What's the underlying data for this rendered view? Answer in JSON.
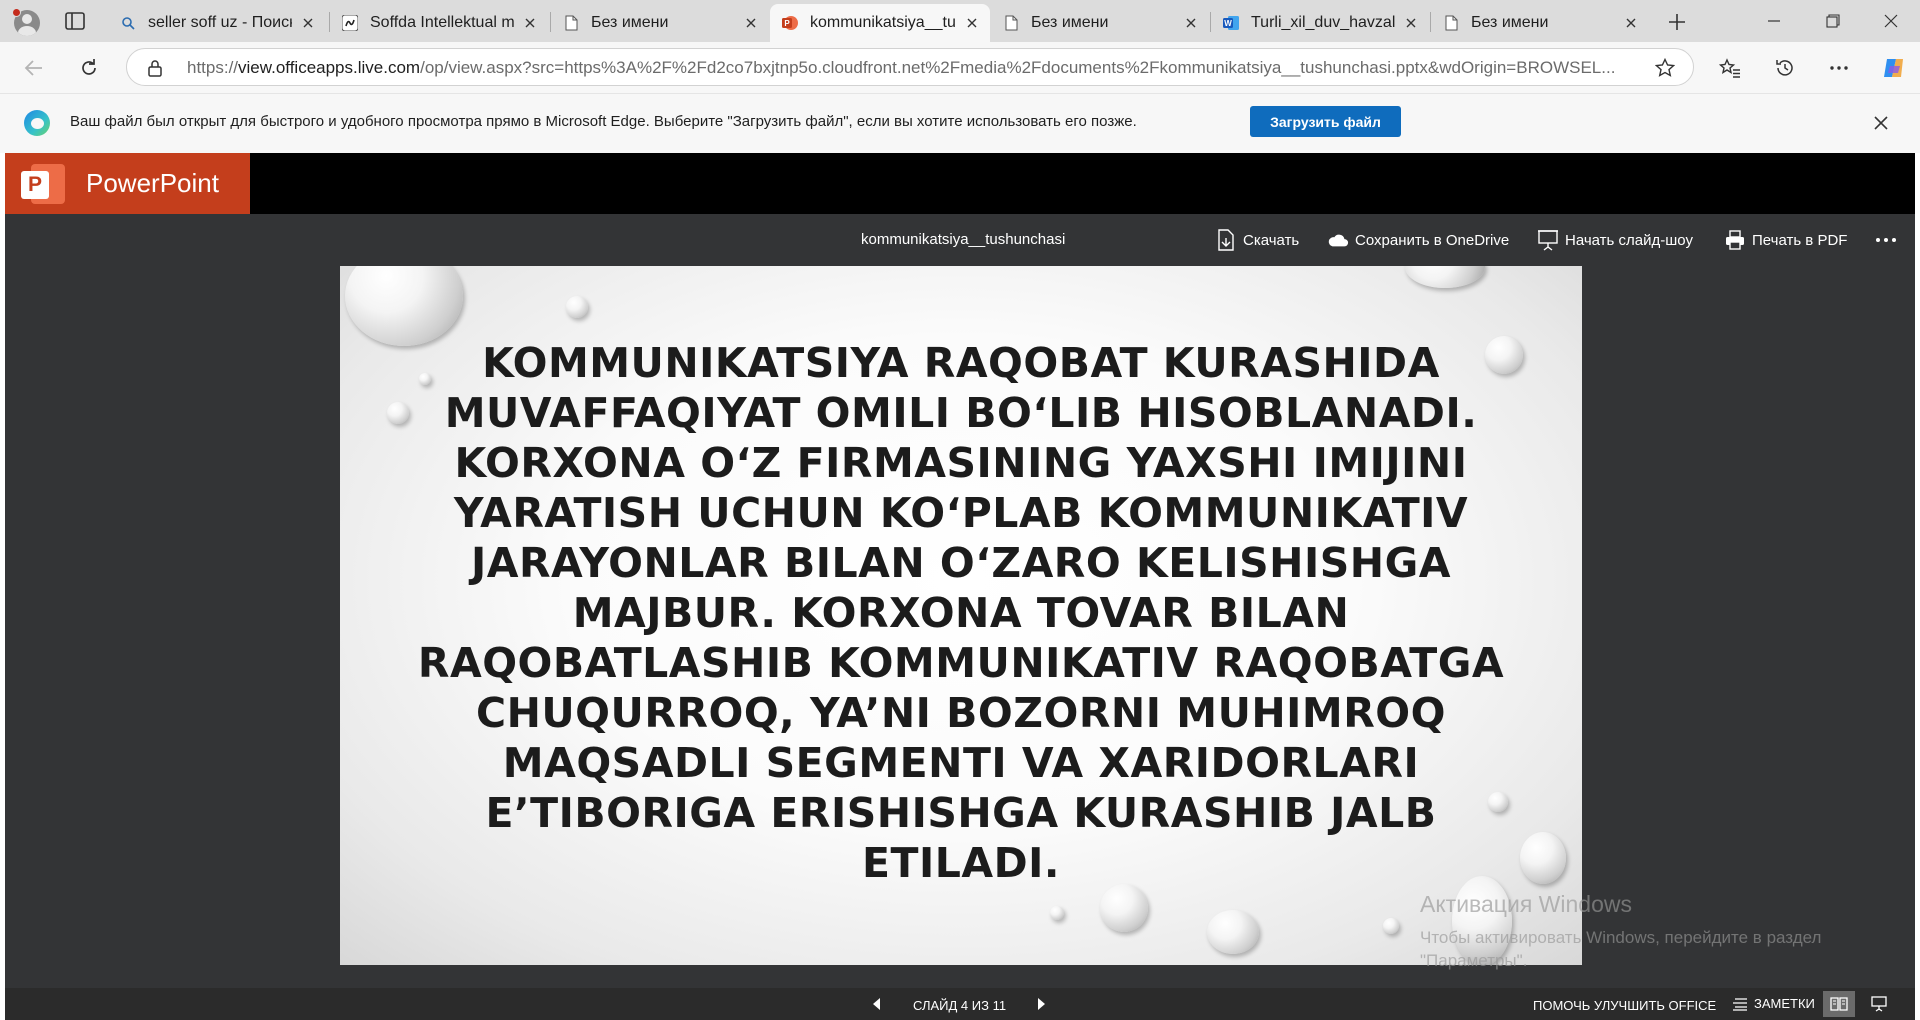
{
  "browser": {
    "tabs": [
      {
        "label": "seller soff uz - Поиск",
        "icon": "search-icon"
      },
      {
        "label": "Soffda Intellektual mu",
        "icon": "soff-icon"
      },
      {
        "label": "Без имени",
        "icon": "page-icon"
      },
      {
        "label": "kommunikatsiya__tushunchasi",
        "icon": "powerpoint-icon",
        "active": true
      },
      {
        "label": "Без имени",
        "icon": "page-icon"
      },
      {
        "label": "Turli_xil_duv_havzalari",
        "icon": "word-icon"
      },
      {
        "label": "Без имени",
        "icon": "page-icon"
      }
    ],
    "address": {
      "prefix": "https://",
      "host": "view.officeapps.live.com",
      "path": "/op/view.aspx?src=https%3A%2F%2Fd2co7bxjtnp5o.cloudfront.net%2Fmedia%2Fdocuments%2Fkommunikatsiya__tushunchasi.pptx&wdOrigin=BROWSEL..."
    },
    "infobar": {
      "message": "Ваш файл был открыт для быстрого и удобного просмотра прямо в Microsoft Edge. Выберите \"Загрузить файл\", если вы хотите использовать его позже.",
      "button": "Загрузить файл"
    }
  },
  "app": {
    "brand": "PowerPoint",
    "document_title": "kommunikatsiya__tushunchasi",
    "commands": {
      "download": "Скачать",
      "save_onedrive": "Сохранить в OneDrive",
      "slideshow": "Начать слайд-шоу",
      "print_pdf": "Печать в PDF"
    },
    "slide": {
      "text": "Kommunikatsiya raqobat kurashida muvaffaqiyat omili bo‘lib hisoblanadi. Korxona o‘z firmasining yaxshi imijini yaratish uchun ko‘plab kommunikativ jarayonlar bilan o‘zaro kelishishga majbur. Korxona tovar bilan raqobatlashib kommunikativ raqobatga chuqurroq, ya’ni bozorni muhimroq maqsadli segmenti va xaridorlari e’tiboriga erishishga kurashib jalb etiladi."
    },
    "status": {
      "slide_counter": "СЛАЙД 4 ИЗ 11",
      "help": "ПОМОЧЬ УЛУЧШИТЬ OFFICE",
      "notes": "ЗАМЕТКИ"
    }
  },
  "watermark": {
    "title": "Активация Windows",
    "text": "Чтобы активировать Windows, перейдите в раздел \"Параметры\"."
  },
  "colors": {
    "accent": "#0f6cbd",
    "powerpoint": "#c43e1c",
    "app_bg": "#333436"
  }
}
